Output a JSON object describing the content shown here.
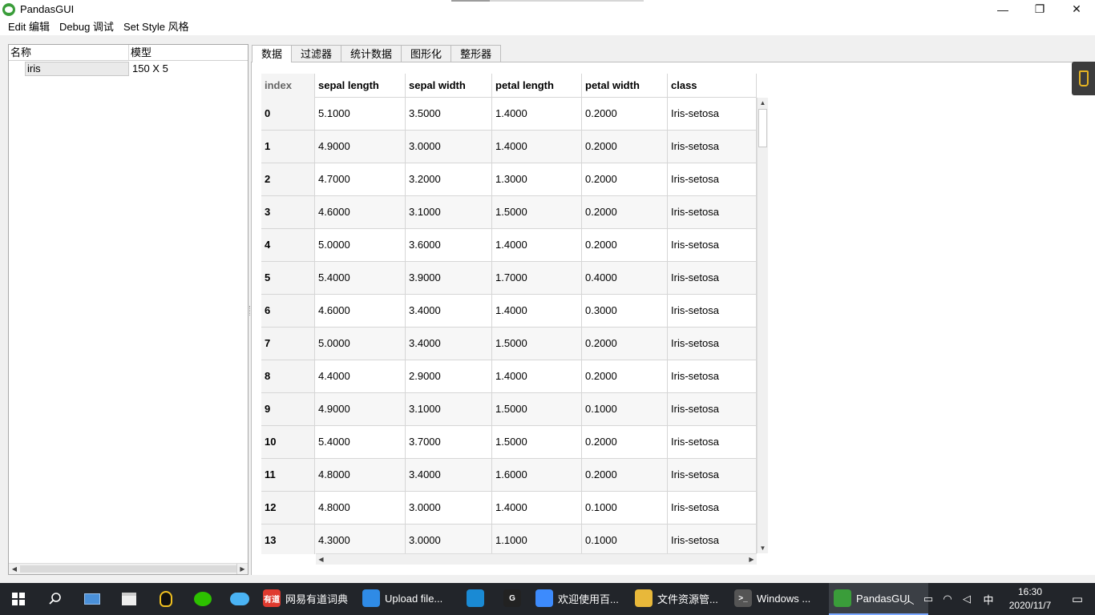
{
  "window": {
    "title": "PandasGUI",
    "minimize_glyph": "—",
    "restore_glyph": "❐",
    "close_glyph": "✕"
  },
  "menu": [
    "Edit 编辑",
    "Debug 调试",
    "Set Style 风格"
  ],
  "tree": {
    "headers": [
      "名称",
      "模型"
    ],
    "items": [
      {
        "name": "iris",
        "shape": "150 X 5"
      }
    ]
  },
  "tabs": [
    "数据",
    "过滤器",
    "统计数据",
    "图形化",
    "整形器"
  ],
  "active_tab": 0,
  "table": {
    "columns": [
      "index",
      "sepal length",
      "sepal width",
      "petal length",
      "petal width",
      "class"
    ],
    "rows": [
      [
        "0",
        "5.1000",
        "3.5000",
        "1.4000",
        "0.2000",
        "Iris-setosa"
      ],
      [
        "1",
        "4.9000",
        "3.0000",
        "1.4000",
        "0.2000",
        "Iris-setosa"
      ],
      [
        "2",
        "4.7000",
        "3.2000",
        "1.3000",
        "0.2000",
        "Iris-setosa"
      ],
      [
        "3",
        "4.6000",
        "3.1000",
        "1.5000",
        "0.2000",
        "Iris-setosa"
      ],
      [
        "4",
        "5.0000",
        "3.6000",
        "1.4000",
        "0.2000",
        "Iris-setosa"
      ],
      [
        "5",
        "5.4000",
        "3.9000",
        "1.7000",
        "0.4000",
        "Iris-setosa"
      ],
      [
        "6",
        "4.6000",
        "3.4000",
        "1.4000",
        "0.3000",
        "Iris-setosa"
      ],
      [
        "7",
        "5.0000",
        "3.4000",
        "1.5000",
        "0.2000",
        "Iris-setosa"
      ],
      [
        "8",
        "4.4000",
        "2.9000",
        "1.4000",
        "0.2000",
        "Iris-setosa"
      ],
      [
        "9",
        "4.9000",
        "3.1000",
        "1.5000",
        "0.1000",
        "Iris-setosa"
      ],
      [
        "10",
        "5.4000",
        "3.7000",
        "1.5000",
        "0.2000",
        "Iris-setosa"
      ],
      [
        "11",
        "4.8000",
        "3.4000",
        "1.6000",
        "0.2000",
        "Iris-setosa"
      ],
      [
        "12",
        "4.8000",
        "3.0000",
        "1.4000",
        "0.1000",
        "Iris-setosa"
      ],
      [
        "13",
        "4.3000",
        "3.0000",
        "1.1000",
        "0.1000",
        "Iris-setosa"
      ]
    ]
  },
  "taskbar": {
    "apps": [
      {
        "label": "网易有道词典",
        "icon": "dictionary-icon",
        "badge": "有道",
        "color": "#e03a2f",
        "active": false
      },
      {
        "label": "Upload file...",
        "icon": "chrome-icon",
        "badge": "",
        "color": "#2f8be6",
        "active": false
      },
      {
        "label": "",
        "icon": "edge-icon",
        "badge": "",
        "color": "#1a8ad4",
        "active": false
      },
      {
        "label": "",
        "icon": "g-app-icon",
        "badge": "G",
        "color": "#222222",
        "active": false
      },
      {
        "label": "欢迎使用百...",
        "icon": "baidu-netdisk-icon",
        "badge": "",
        "color": "#3d8bfd",
        "active": false
      },
      {
        "label": "文件资源管...",
        "icon": "folder-icon",
        "badge": "",
        "color": "#e8b83a",
        "active": false
      },
      {
        "label": "Windows ...",
        "icon": "terminal-icon",
        "badge": ">_",
        "color": "#555555",
        "active": false
      },
      {
        "label": "PandasGUI",
        "icon": "pandas-icon",
        "badge": "",
        "color": "#3a9d3a",
        "active": true
      }
    ],
    "ime": "中",
    "time": "16:30",
    "date": "2020/11/7"
  },
  "colors": {
    "accent": "#7aa7ff",
    "taskbar": "#22252a",
    "app_icon": "#3a9d3a"
  }
}
